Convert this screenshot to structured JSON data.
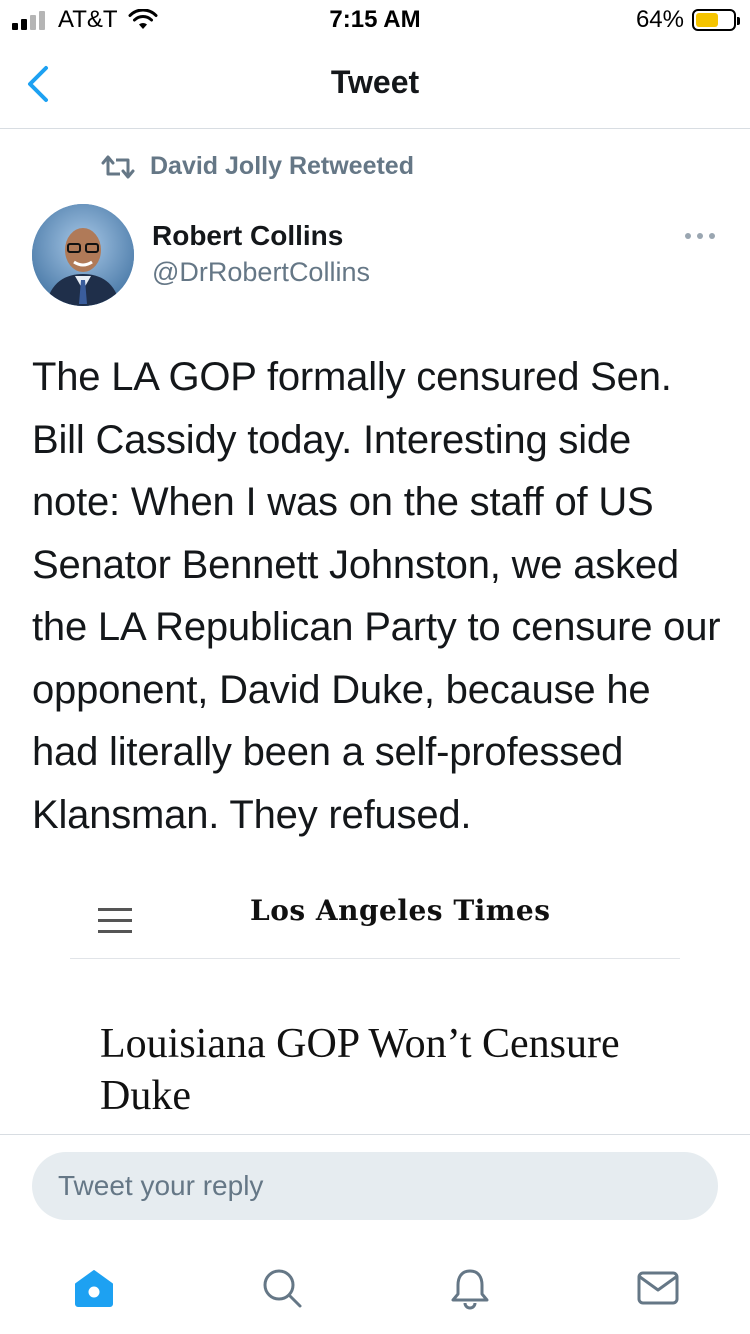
{
  "status_bar": {
    "carrier": "AT&T",
    "time": "7:15 AM",
    "battery_percent": "64%",
    "battery_level": 0.64
  },
  "nav": {
    "title": "Tweet",
    "back_icon": "chevron-left-icon"
  },
  "tweet": {
    "retweeted_by": "David Jolly Retweeted",
    "author_name": "Robert Collins",
    "author_handle": "@DrRobertCollins",
    "text": "The LA GOP formally censured Sen. Bill Cassidy today. Interesting side note: When I was on the staff of US Senator Bennett Johnston, we asked the LA Republican Party to censure our opponent, David Duke, because he had literally been a self-professed Klansman. They refused."
  },
  "embedded_image": {
    "publication": "Los Angeles Times",
    "headline": "Louisiana GOP Won’t Censure Duke"
  },
  "reply": {
    "placeholder": "Tweet your reply"
  },
  "tabs": [
    {
      "name": "home",
      "icon": "home-icon",
      "active": true
    },
    {
      "name": "search",
      "icon": "search-icon",
      "active": false
    },
    {
      "name": "notifications",
      "icon": "bell-icon",
      "active": false
    },
    {
      "name": "messages",
      "icon": "mail-icon",
      "active": false
    }
  ],
  "colors": {
    "accent": "#1da1f2",
    "secondary_text": "#657786",
    "battery_fill": "#f5c400"
  }
}
